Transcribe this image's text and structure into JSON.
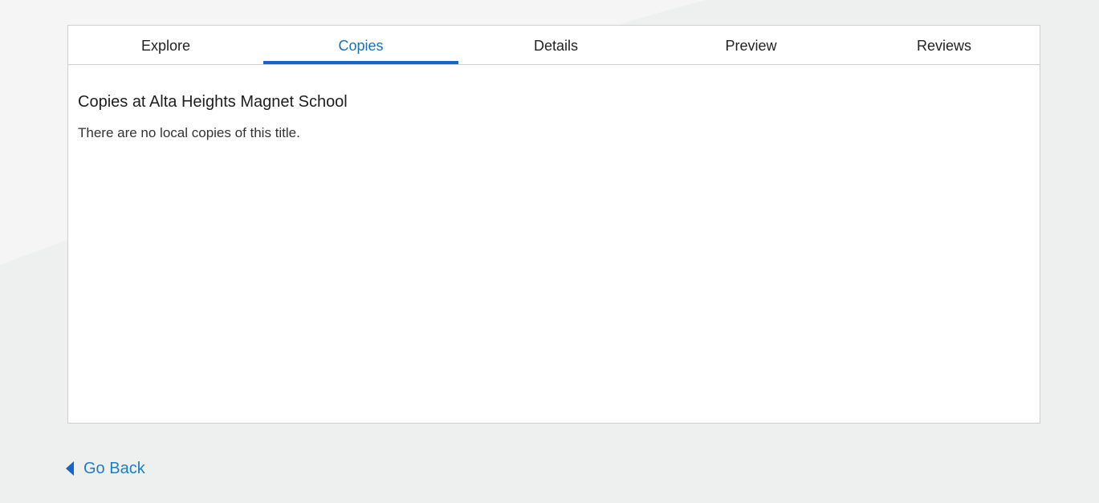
{
  "tabs": [
    {
      "label": "Explore"
    },
    {
      "label": "Copies"
    },
    {
      "label": "Details"
    },
    {
      "label": "Preview"
    },
    {
      "label": "Reviews"
    }
  ],
  "active_tab": "Copies",
  "copies": {
    "title": "Copies at Alta Heights Magnet School",
    "message": "There are no local copies of this title."
  },
  "footer": {
    "back_label": "Go Back",
    "back_icon": "caret-left-icon"
  },
  "colors": {
    "accent": "#1565c8",
    "link": "#1a7fc4",
    "background": "#eef0ef"
  }
}
